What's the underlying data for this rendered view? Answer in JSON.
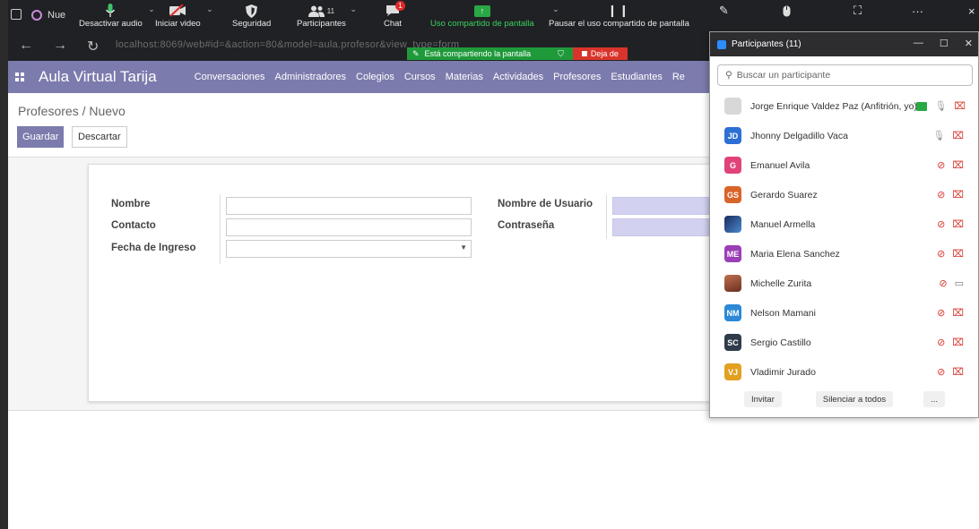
{
  "browser": {
    "tab_title": "Nue",
    "url": "localhost:8069/web#id=&action=80&model=aula.profesor&view_type=form"
  },
  "zoom": {
    "audio": "Desactivar audio",
    "video": "Iniciar video",
    "security": "Seguridad",
    "participants": "Participantes",
    "participants_count": "11",
    "chat": "Chat",
    "chat_badge": "1",
    "share": "Uso compartido de pantalla",
    "pause_share": "Pausar el uso compartido de pantalla",
    "sharing_notice": "Está compartiendo la pantalla",
    "stop_share": "Deja de"
  },
  "odoo": {
    "brand": "Aula Virtual Tarija",
    "menu": [
      "Conversaciones",
      "Administradores",
      "Colegios",
      "Cursos",
      "Materias",
      "Actividades",
      "Profesores",
      "Estudiantes",
      "Re"
    ],
    "breadcrumb": "Profesores / Nuevo",
    "save": "Guardar",
    "discard": "Descartar",
    "form": {
      "nombre": "Nombre",
      "contacto": "Contacto",
      "fecha_ingreso": "Fecha de Ingreso",
      "usuario": "Nombre de Usuario",
      "contrasena": "Contraseña"
    }
  },
  "panel": {
    "title": "Participantes (11)",
    "search_placeholder": "Buscar un participante",
    "participants": [
      {
        "name": "Jorge Enrique Valdez Paz (Anfitrión, yo)",
        "initials": "",
        "color": "#d8d8d8"
      },
      {
        "name": "Jhonny Delgadillo Vaca",
        "initials": "JD",
        "color": "#2d6fd2"
      },
      {
        "name": "Emanuel Avila",
        "initials": "G",
        "color": "#e0427a"
      },
      {
        "name": "Gerardo Suarez",
        "initials": "GS",
        "color": "#d9642a"
      },
      {
        "name": "Manuel Armella",
        "initials": "",
        "color": "#3a5aa0"
      },
      {
        "name": "Maria Elena Sanchez",
        "initials": "ME",
        "color": "#9b3fb6"
      },
      {
        "name": "Michelle Zurita",
        "initials": "",
        "color": "#b0543d"
      },
      {
        "name": "Nelson Mamani",
        "initials": "NM",
        "color": "#2d89d6"
      },
      {
        "name": "Sergio Castillo",
        "initials": "SC",
        "color": "#2f3b4a"
      },
      {
        "name": "Vladimir Jurado",
        "initials": "VJ",
        "color": "#e3a021"
      }
    ],
    "invite": "Invitar",
    "mute_all": "Silenciar a todos",
    "more": "..."
  }
}
